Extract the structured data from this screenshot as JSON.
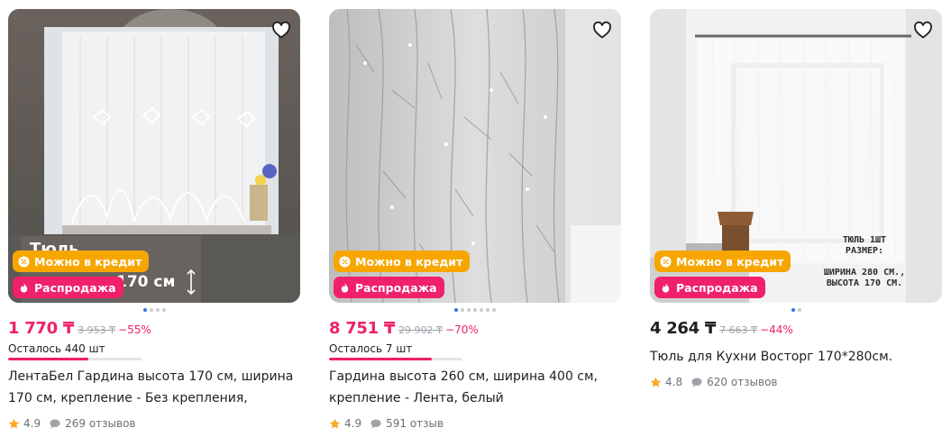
{
  "colors": {
    "sale_pink": "#f0206a",
    "credit_orange": "#f7a600",
    "star": "#f9a825",
    "dot_active": "#2f74e6"
  },
  "products": [
    {
      "badges": {
        "credit": "Можно в кредит",
        "sale": "Распродажа"
      },
      "image_overlay": {
        "line1": "Тюль",
        "line2": "170 см"
      },
      "price": "1 770 ₸",
      "old_price": "3 953 ₸",
      "discount": "−55%",
      "stock": "Осталось 440 шт",
      "stock_level": 0.6,
      "title": "ЛентаБел Гардина высота 170 см, ширина 170 см, крепление - Без крепления,",
      "rating": "4.9",
      "reviews": "269 отзывов",
      "carousel": {
        "count": 4,
        "active": 1
      }
    },
    {
      "badges": {
        "credit": "Можно в кредит",
        "sale": "Распродажа"
      },
      "price": "8 751 ₸",
      "old_price": "29 902 ₸",
      "discount": "−70%",
      "stock": "Осталось 7 шт",
      "stock_level": 0.77,
      "title": "Гардина высота 260 см, ширина 400 см, крепление - Лента, белый",
      "rating": "4.9",
      "reviews": "591 отзыв",
      "carousel": {
        "count": 7,
        "active": 1
      }
    },
    {
      "badges": {
        "credit": "Можно в кредит",
        "sale": "Распродажа"
      },
      "image_overlay": {
        "lines": [
          "ТЮЛЬ 1ШТ",
          "РАЗМЕР:",
          "ШИРИНА 280 СМ.,",
          "ВЫСОТА 170 СМ."
        ]
      },
      "price": "4 264 ₸",
      "old_price": "7 663 ₸",
      "discount": "−44%",
      "title": "Тюль для Кухни Восторг 170*280см.",
      "rating": "4.8",
      "reviews": "620 отзывов",
      "carousel": {
        "count": 2,
        "active": 1
      }
    }
  ]
}
